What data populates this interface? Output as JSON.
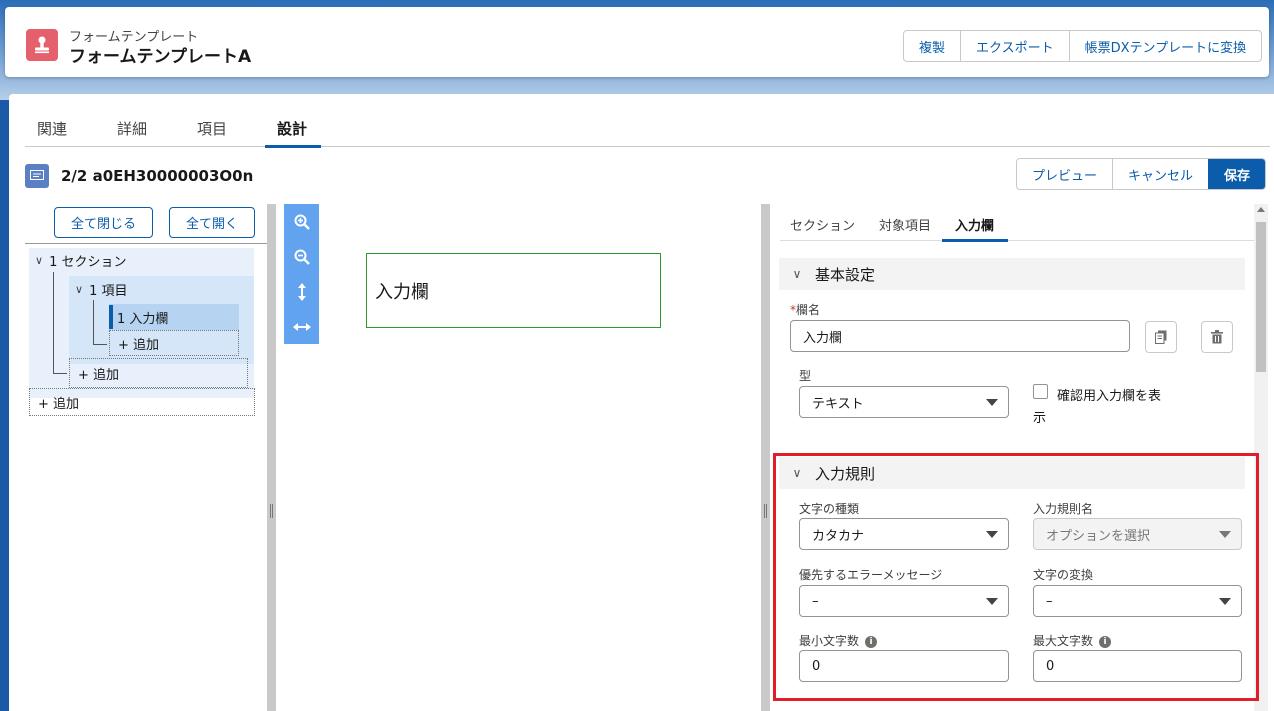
{
  "header": {
    "object_label": "フォームテンプレート",
    "record_name": "フォームテンプレートA",
    "actions": [
      "複製",
      "エクスポート",
      "帳票DXテンプレートに変換"
    ]
  },
  "tabs": [
    "関連",
    "詳細",
    "項目",
    "設計"
  ],
  "active_tab": "設計",
  "designer": {
    "title": "2/2 a0EH30000003O0n",
    "actions": [
      "プレビュー",
      "キャンセル",
      "保存"
    ]
  },
  "tree": {
    "collapse_all": "全て閉じる",
    "expand_all": "全て開く",
    "section": "1 セクション",
    "item": "1 項目",
    "input": "1 入力欄",
    "add": "+ 追加"
  },
  "canvas": {
    "field_label": "入力欄"
  },
  "panel": {
    "tabs": [
      "セクション",
      "対象項目",
      "入力欄"
    ],
    "active_tab": "入力欄",
    "basic": {
      "title": "基本設定",
      "name_label": "欄名",
      "name_value": "入力欄",
      "type_label": "型",
      "type_value": "テキスト",
      "confirm_label_1": "確認用入力欄を表",
      "confirm_label_2": "示"
    },
    "rules": {
      "title": "入力規則",
      "char_type_label": "文字の種類",
      "char_type_value": "カタカナ",
      "rule_name_label": "入力規則名",
      "rule_name_placeholder": "オプションを選択",
      "error_msg_label": "優先するエラーメッセージ",
      "error_msg_value": "–",
      "convert_label": "文字の変換",
      "convert_value": "–",
      "min_label": "最小文字数",
      "min_value": "0",
      "max_label": "最大文字数",
      "max_value": "0"
    }
  },
  "colors": {
    "brand": "#0b5cab",
    "highlight": "#e01e2a",
    "canvas_field_border": "#2e9a2e",
    "logo": "#e4606d"
  }
}
